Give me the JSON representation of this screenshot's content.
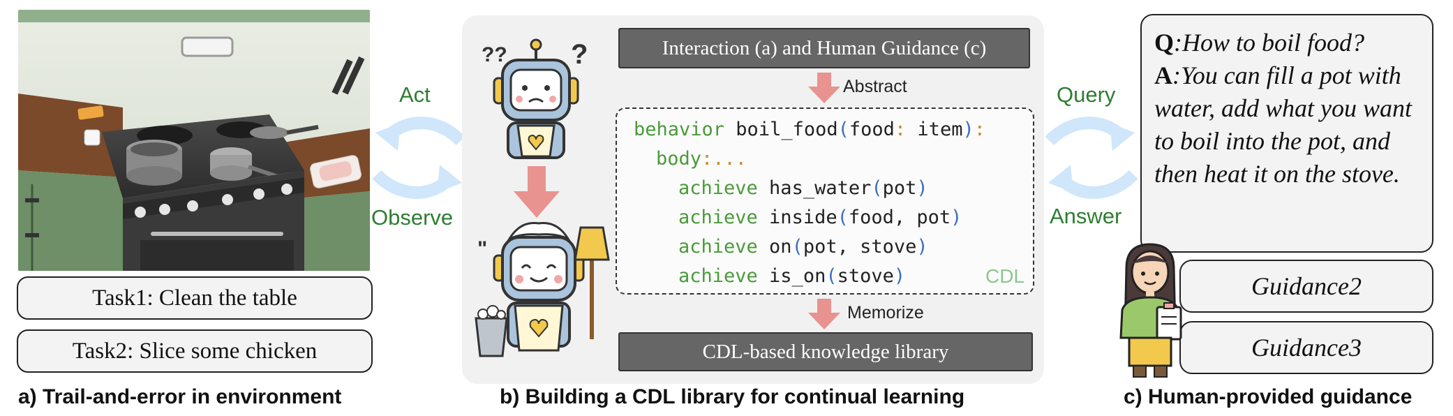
{
  "panel_a": {
    "arrow_top_label": "Act",
    "arrow_bottom_label": "Observe",
    "tasks": [
      "Task1: Clean the table",
      "Task2: Slice some chicken"
    ],
    "caption": "a) Trail-and-error in environment"
  },
  "panel_b": {
    "top_box": "Interaction (a) and Human Guidance (c)",
    "abstract_label": "Abstract",
    "memorize_label": "Memorize",
    "bottom_box": "CDL-based knowledge library",
    "code_tag": "CDL",
    "code": {
      "l1_kw": "behavior",
      "l1_name": " boil_food",
      "l1_p1": "(",
      "l1_args": "food",
      "l1_colon": ":",
      "l1_type": " item",
      "l1_p2": ")",
      "l1_end": ":",
      "l2_kw": "body",
      "l2_end": ":...",
      "l3_kw": "achieve",
      "l3_fn": " has_water",
      "l3_open": "(",
      "l3_arg": "pot",
      "l3_close": ")",
      "l4_kw": "achieve",
      "l4_fn": " inside",
      "l4_open": "(",
      "l4_arg": "food, pot",
      "l4_close": ")",
      "l5_kw": "achieve",
      "l5_fn": " on",
      "l5_open": "(",
      "l5_arg": "pot, stove",
      "l5_close": ")",
      "l6_kw": "achieve",
      "l6_fn": " is_on",
      "l6_open": "(",
      "l6_arg": "stove",
      "l6_close": ")"
    },
    "caption": "b) Building a CDL library for continual learning",
    "robot_marks": [
      "??",
      "?",
      "\""
    ]
  },
  "panel_c": {
    "arrow_top_label": "Query",
    "arrow_bottom_label": "Answer",
    "q_prefix": "Q",
    "q_text": ":How to boil food?",
    "a_prefix": "A",
    "a_text": ":You can fill a pot with water, add what you want to boil into the pot, and then heat it on the stove.",
    "guidance": [
      "Guidance2",
      "Guidance3"
    ],
    "caption": "c) Human-provided guidance"
  },
  "colors": {
    "arrow_blue": "#cfe6fb",
    "arrow_pink": "#e8938f",
    "label_green": "#2e7d32",
    "dark_box": "#666666",
    "keyword_green": "#4a9a3a",
    "paren_blue": "#3a6fc0"
  }
}
